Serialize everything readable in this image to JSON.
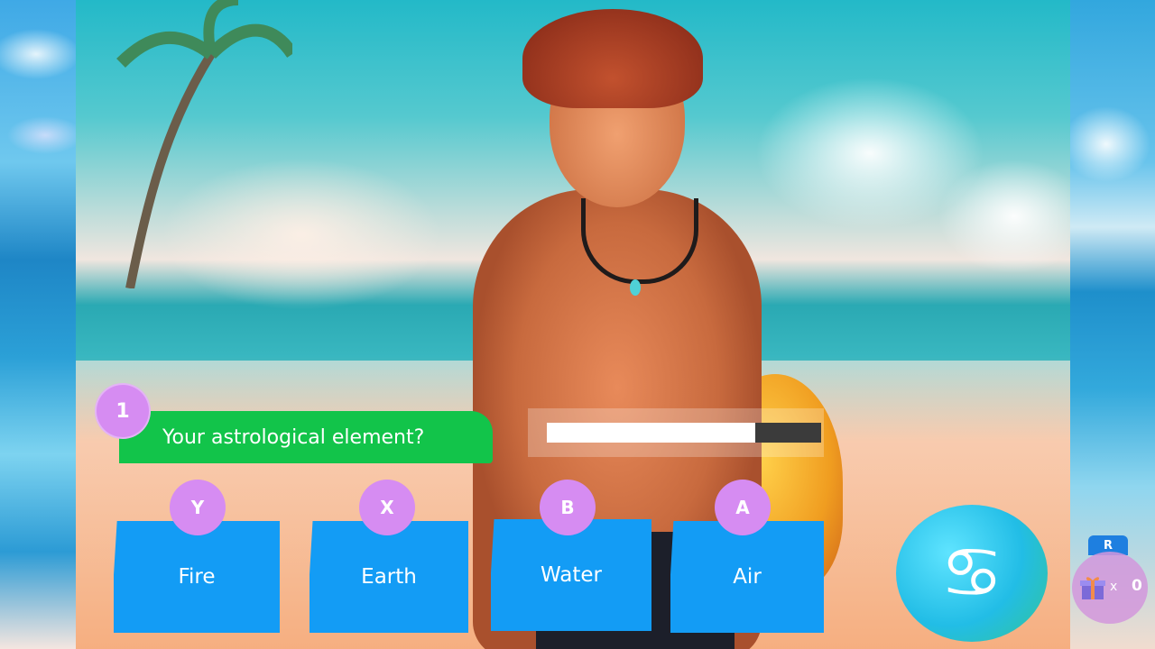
{
  "question": {
    "number": "1",
    "text": "Your astrological element?"
  },
  "timer": {
    "remaining_fraction": 0.76
  },
  "answers": [
    {
      "key": "Y",
      "label": "Fire"
    },
    {
      "key": "X",
      "label": "Earth"
    },
    {
      "key": "B",
      "label": "Water"
    },
    {
      "key": "A",
      "label": "Air"
    }
  ],
  "zodiac": {
    "symbol": "♋",
    "icon": "cancer-zodiac-icon"
  },
  "inventory": {
    "button_hint": "R",
    "multiplier": "x",
    "count": "0",
    "icon": "gift-icon"
  },
  "colors": {
    "question_bar": "#12c44a",
    "answer_button": "#139cf5",
    "key_badge": "#d68cf2"
  }
}
